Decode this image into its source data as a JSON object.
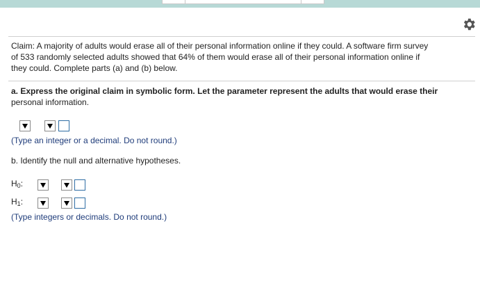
{
  "claim_text": [
    "Claim: A majority of adults would erase all of their personal information online if they could. A software firm survey",
    "of 533 randomly selected adults showed that 64% of them would erase all of their personal information online if",
    "they could. Complete parts (a) and (b) below."
  ],
  "part_a": {
    "prompt": [
      "a. Express the original claim in symbolic form. Let the parameter represent the adults that would erase their",
      "personal information."
    ],
    "hint": "(Type an integer or a decimal. Do not round.)"
  },
  "part_b": {
    "prompt": "b. Identify the null and alternative hypotheses.",
    "h0_label": "H",
    "h0_sub": "0",
    "h1_label": "H",
    "h1_sub": "1",
    "colon": ":",
    "hint": "(Type integers or decimals. Do not round.)"
  },
  "icons": {
    "settings": "gear-icon",
    "dropdown": "triangle-down-icon"
  },
  "colors": {
    "topbar": "#b7d9d6",
    "hint_text": "#1f3c7a",
    "input_border": "#2e6da4"
  }
}
